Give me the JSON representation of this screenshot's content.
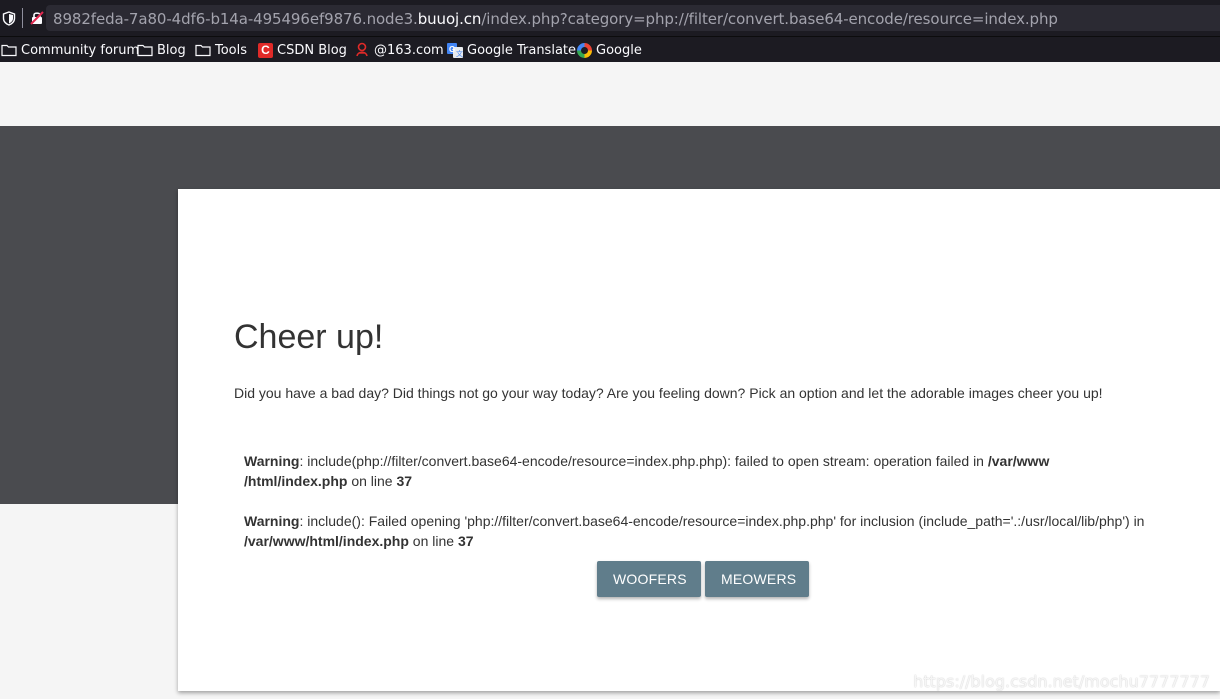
{
  "browser": {
    "url_prefix": "8982feda-7a80-4df6-b14a-495496ef9876.node3.",
    "url_host": "buuoj.cn",
    "url_path": "/index.php?category=php://filter/convert.base64-encode/resource=index.php",
    "icons": {
      "shield": "tracking-protection-shield-icon",
      "insecure": "insecure-connection-lock-icon"
    }
  },
  "bookmarks": [
    {
      "label": "Community forum",
      "icon": "folder-icon"
    },
    {
      "label": "Blog",
      "icon": "folder-icon"
    },
    {
      "label": "Tools",
      "icon": "folder-icon"
    },
    {
      "label": "CSDN Blog",
      "icon": "csdn-icon",
      "icon_text": "C"
    },
    {
      "label": "@163.com",
      "icon": "163-mail-icon"
    },
    {
      "label": "Google Translate",
      "icon": "google-translate-icon"
    },
    {
      "label": "Google",
      "icon": "google-icon"
    }
  ],
  "page": {
    "title": "Cheer up!",
    "lead": "Did you have a bad day? Did things not go your way today? Are you feeling down? Pick an option and let the adorable images cheer you up!",
    "warnings": [
      {
        "label": "Warning",
        "text": ": include(php://filter/convert.base64-encode/resource=index.php.php): failed to open stream: operation failed in ",
        "path_a": "/var/www",
        "path_b": "/html/index.php",
        "on_line": " on line ",
        "line": "37"
      },
      {
        "label": "Warning",
        "text": ": include(): Failed opening 'php://filter/convert.base64-encode/resource=index.php.php' for inclusion (include_path='.:/usr/local/lib/php') in ",
        "path": "/var/www/html/index.php",
        "on_line": " on line ",
        "line": "37"
      }
    ],
    "buttons": {
      "woofers": "WOOFERS",
      "meowers": "MEOWERS"
    },
    "watermark": "https://blog.csdn.net/mochu7777777"
  },
  "colors": {
    "browser_chrome": "#1c1b22",
    "url_field": "#2b2a33",
    "dark_band": "#4a4b4f",
    "button": "#607d8b",
    "csdn_red": "#e02a28"
  }
}
